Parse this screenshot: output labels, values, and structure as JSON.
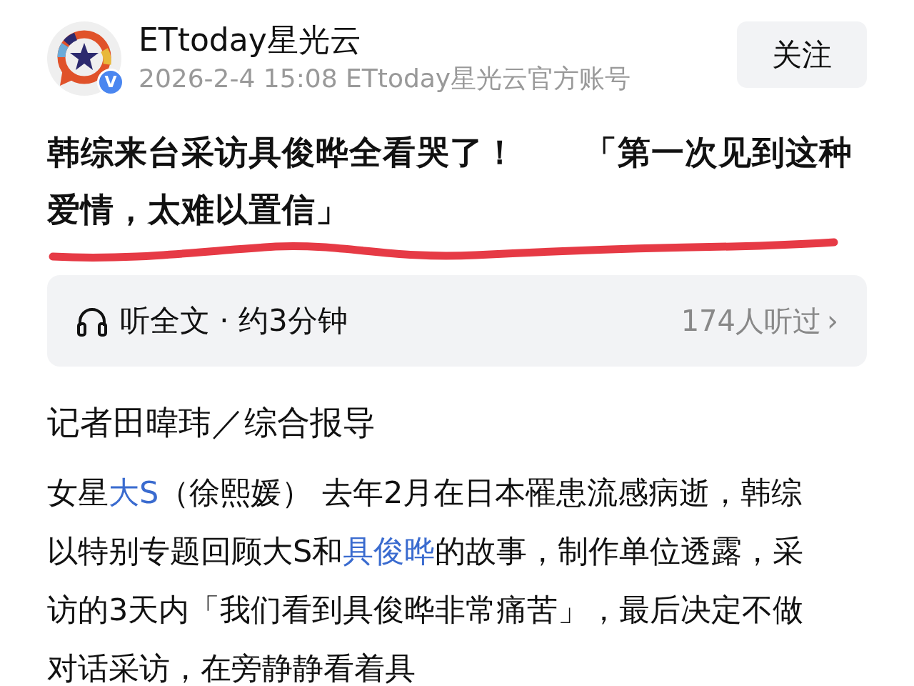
{
  "author": {
    "name": "ETtoday星光云",
    "badge": "V",
    "date": "2026-2-4",
    "time": "15:08",
    "account": "ETtoday星光云官方账号"
  },
  "follow_button": {
    "label": "关注"
  },
  "title": "韩综来台采访具俊晔全看哭了！　　「第一次见到这种爱情，太难以置信」",
  "audio": {
    "label": "听全文 · 约3分钟",
    "listeners": "174人听过",
    "chevron": "›"
  },
  "byline": "记者田暐玮／综合报导",
  "paragraph": [
    {
      "text": "女星",
      "link": false
    },
    {
      "text": "大S",
      "link": true
    },
    {
      "text": "（徐熙媛） 去年2月在日本罹患流感病逝，韩综以特别专题回顾大S和",
      "link": false
    },
    {
      "text": "具俊晔",
      "link": true
    },
    {
      "text": "的故事，制作单位透露，采访的3天内「我们看到具俊晔非常痛苦」，最后决定不做对话采访，在旁静静看着具",
      "link": false
    }
  ]
}
